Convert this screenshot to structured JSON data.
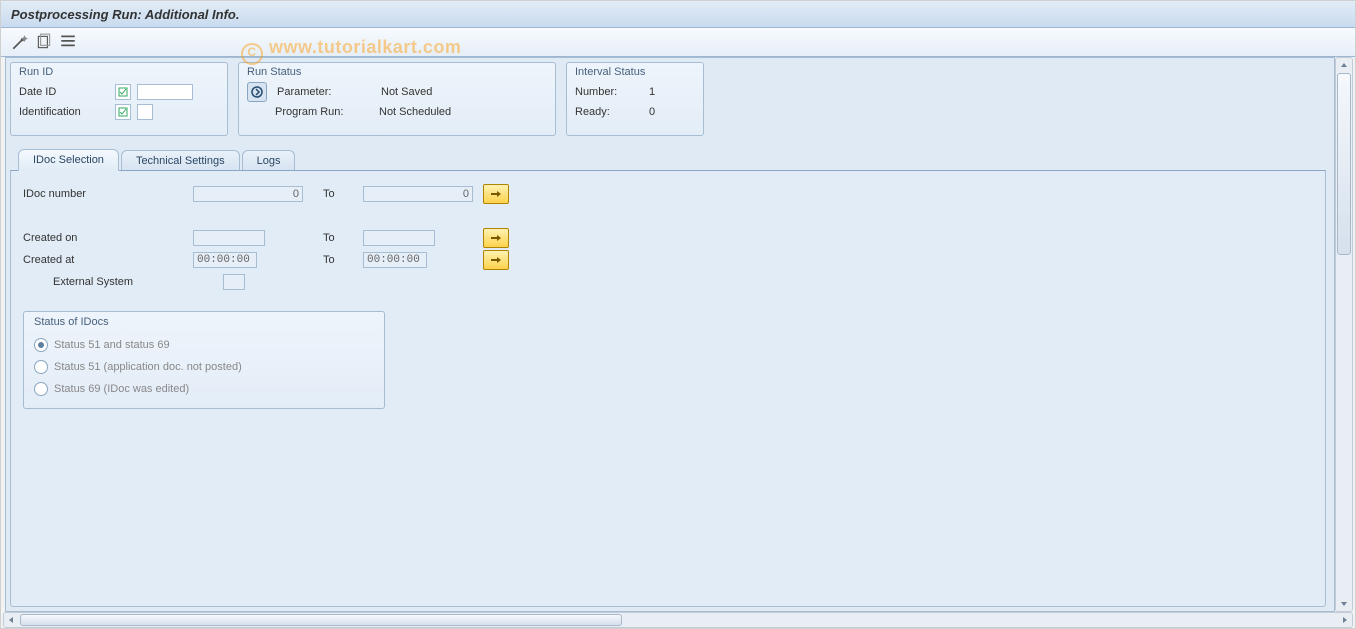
{
  "page_title": "Postprocessing Run: Additional Info.",
  "watermark": "www.tutorialkart.com",
  "groups": {
    "run_id": {
      "title": "Run ID",
      "date_id_label": "Date ID",
      "identification_label": "Identification"
    },
    "run_status": {
      "title": "Run Status",
      "parameter_label": "Parameter:",
      "parameter_value": "Not Saved",
      "program_run_label": "Program Run:",
      "program_run_value": "Not Scheduled"
    },
    "interval_status": {
      "title": "Interval Status",
      "number_label": "Number:",
      "number_value": "1",
      "ready_label": "Ready:",
      "ready_value": "0"
    }
  },
  "tabs": {
    "idoc_selection": "IDoc Selection",
    "technical_settings": "Technical Settings",
    "logs": "Logs"
  },
  "form": {
    "idoc_number_label": "IDoc number",
    "idoc_number_from": "0",
    "idoc_number_to": "0",
    "to_label": "To",
    "created_on_label": "Created on",
    "created_on_from": "",
    "created_on_to": "",
    "created_at_label": "Created at",
    "created_at_from": "00:00:00",
    "created_at_to": "00:00:00",
    "external_system_label": "External System",
    "external_system_value": ""
  },
  "status_group": {
    "title": "Status of IDocs",
    "opt1": "Status 51 and status 69",
    "opt2": "Status 51 (application doc. not posted)",
    "opt3": "Status 69 (IDoc was edited)"
  }
}
